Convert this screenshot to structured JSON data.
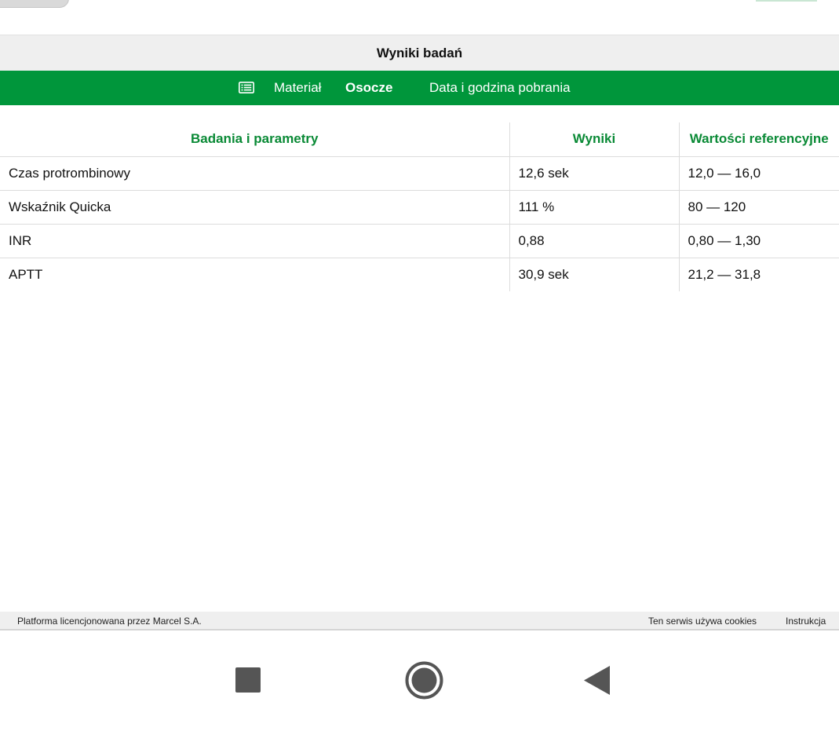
{
  "header": {
    "title": "Wyniki badań"
  },
  "material": {
    "icon": "list-icon",
    "label": "Materiał",
    "value": "Osocze",
    "date_label": "Data i godzina pobrania"
  },
  "table": {
    "columns": [
      "Badania i parametry",
      "Wyniki",
      "Wartości referencyjne"
    ],
    "rows": [
      {
        "name": "Czas protrombinowy",
        "result": "12,6 sek",
        "reference": "12,0 — 16,0"
      },
      {
        "name": "Wskaźnik Quicka",
        "result": "111 %",
        "reference": "80 — 120"
      },
      {
        "name": "INR",
        "result": "0,88",
        "reference": "0,80 — 1,30"
      },
      {
        "name": "APTT",
        "result": "30,9 sek",
        "reference": "21,2 — 31,8"
      }
    ]
  },
  "footer": {
    "license": "Platforma licencjonowana przez Marcel S.A.",
    "cookies": "Ten serwis używa cookies",
    "instructions": "Instrukcja"
  },
  "navbar": {
    "recents": "recents-icon",
    "home": "home-icon",
    "back": "back-icon"
  },
  "colors": {
    "accent": "#00963b",
    "header_text": "#0a8a36",
    "header_bg": "#efefef"
  }
}
